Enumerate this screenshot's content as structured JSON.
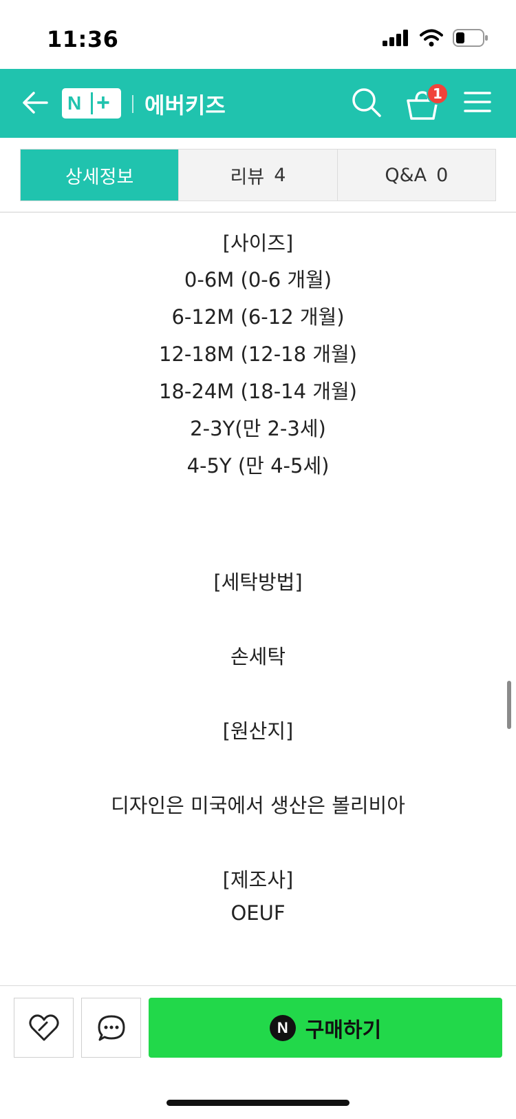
{
  "status_bar": {
    "time": "11:36"
  },
  "header": {
    "logo_n": "N",
    "logo_plus": "+",
    "store_name": "에버키즈",
    "cart_count": "1",
    "icons": {
      "back": "arrow-left-icon",
      "search": "search-icon",
      "cart": "shopping-basket-icon",
      "menu": "hamburger-menu-icon"
    }
  },
  "tabs": [
    {
      "label": "상세정보",
      "count": ""
    },
    {
      "label": "리뷰",
      "count": "4"
    },
    {
      "label": "Q&A",
      "count": "0"
    }
  ],
  "content": {
    "size_heading": "[사이즈]",
    "sizes": [
      "0-6M (0-6 개월)",
      "6-12M (6-12 개월)",
      "12-18M (12-18 개월)",
      "18-24M (18-14 개월)",
      "2-3Y(만 2-3세)",
      "4-5Y (만 4-5세)"
    ],
    "wash_heading": "[세탁방법]",
    "wash_method": "손세탁",
    "origin_heading": "[원산지]",
    "origin": "디자인은 미국에서 생산은 볼리비아",
    "maker_heading": "[제조사]",
    "maker": "OEUF"
  },
  "bottom_bar": {
    "buy_icon_letter": "N",
    "buy_label": "구매하기",
    "icons": {
      "like": "heart-icon",
      "talk": "chat-bubble-icon"
    }
  },
  "colors": {
    "brand": "#20c3ae",
    "buy": "#22d84a",
    "badge": "#f0433a"
  }
}
